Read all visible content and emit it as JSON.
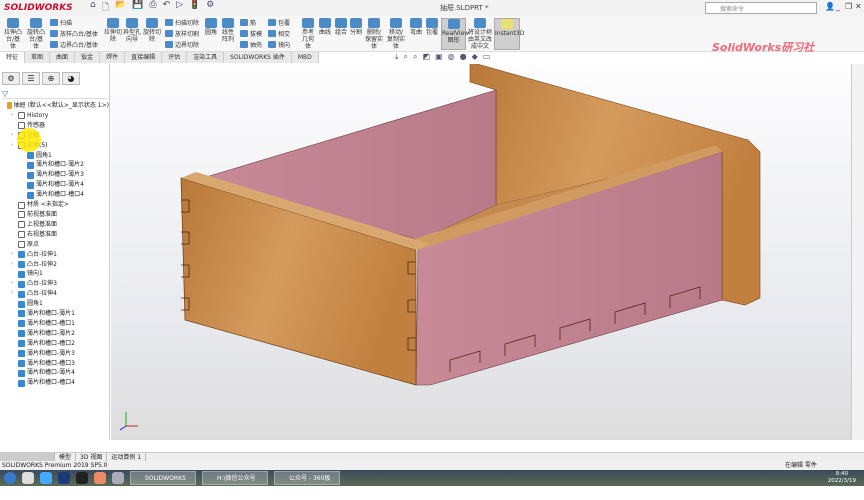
{
  "app": {
    "logo": "SOLIDWORKS",
    "doc_title": "抽屉.SLDPRT *",
    "search_placeholder": "搜索命令",
    "brand_watermark": "SolidWorks研习社"
  },
  "ribbon": {
    "big": [
      "拉伸凸台/基体",
      "旋转凸台/基体",
      "拉伸切除",
      "异型孔向导",
      "旋转切除",
      "圆角",
      "线性阵列",
      "参考几何体",
      "曲线",
      "组合",
      "分割",
      "删除/保留实体",
      "移动/复制实体",
      "弯曲",
      "包覆",
      "RealView图形",
      "将设计树由英文改成中文",
      "Instant3D"
    ],
    "small": [
      "扫描",
      "放样凸台/基体",
      "边界凸台/基体",
      "扫描切除",
      "放样切割",
      "边界切除",
      "筋",
      "拔模",
      "抽壳",
      "包覆",
      "相交",
      "镜向"
    ]
  },
  "tabs": [
    "特征",
    "草图",
    "曲面",
    "钣金",
    "焊件",
    "直接编辑",
    "评估",
    "渲染工具",
    "SOLIDWORKS 插件",
    "MBD"
  ],
  "tree": [
    {
      "label": "抽屉 (默认<<默认>_显示状态 1>)",
      "icon": "part",
      "level": 0
    },
    {
      "label": "History",
      "icon": "folder",
      "level": 1,
      "arrow": true
    },
    {
      "label": "传感器",
      "icon": "folder",
      "level": 1
    },
    {
      "label": "注解",
      "icon": "folder",
      "level": 1,
      "arrow": true
    },
    {
      "label": "实体(5)",
      "icon": "folder",
      "level": 1,
      "arrow": true
    },
    {
      "label": "圆角1",
      "icon": "body",
      "level": 2
    },
    {
      "label": "薄片和槽口-薄片2",
      "icon": "body",
      "level": 2
    },
    {
      "label": "薄片和槽口-薄片3",
      "icon": "body",
      "level": 2
    },
    {
      "label": "薄片和槽口-薄片4",
      "icon": "body",
      "level": 2
    },
    {
      "label": "薄片和槽口-槽口4",
      "icon": "body",
      "level": 2
    },
    {
      "label": "材质 <未指定>",
      "icon": "material",
      "level": 1
    },
    {
      "label": "前视基准面",
      "icon": "plane",
      "level": 1
    },
    {
      "label": "上视基准面",
      "icon": "plane",
      "level": 1
    },
    {
      "label": "右视基准面",
      "icon": "plane",
      "level": 1
    },
    {
      "label": "原点",
      "icon": "origin",
      "level": 1
    },
    {
      "label": "凸台-拉伸1",
      "icon": "feature",
      "level": 1,
      "arrow": true
    },
    {
      "label": "凸台-拉伸2",
      "icon": "feature",
      "level": 1,
      "arrow": true
    },
    {
      "label": "镜向1",
      "icon": "feature",
      "level": 1
    },
    {
      "label": "凸台-拉伸3",
      "icon": "feature",
      "level": 1,
      "arrow": true
    },
    {
      "label": "凸台-拉伸4",
      "icon": "feature",
      "level": 1,
      "arrow": true
    },
    {
      "label": "圆角1",
      "icon": "feature",
      "level": 1
    },
    {
      "label": "薄片和槽口-薄片1",
      "icon": "feature",
      "level": 1
    },
    {
      "label": "薄片和槽口-槽口1",
      "icon": "feature",
      "level": 1
    },
    {
      "label": "薄片和槽口-薄片2",
      "icon": "feature",
      "level": 1
    },
    {
      "label": "薄片和槽口-槽口2",
      "icon": "feature",
      "level": 1
    },
    {
      "label": "薄片和槽口-薄片3",
      "icon": "feature",
      "level": 1
    },
    {
      "label": "薄片和槽口-槽口3",
      "icon": "feature",
      "level": 1
    },
    {
      "label": "薄片和槽口-薄片4",
      "icon": "feature",
      "level": 1
    },
    {
      "label": "薄片和槽口-槽口4",
      "icon": "feature",
      "level": 1
    }
  ],
  "bottom_tabs": [
    "模型",
    "3D 视图",
    "运动算例 1"
  ],
  "status": {
    "left": "SOLIDWORKS Premium 2019 SP5.0",
    "right": "在编辑 零件"
  },
  "taskbar": {
    "windows": [
      "SOLIDWORKS P...",
      "H:\\微信公众号\\0...",
      "公众号 - 360极速..."
    ],
    "time": "8:40",
    "date": "2022/3/19"
  },
  "colors": {
    "wood": "#c98a4b",
    "pink": "#c98a98",
    "accent": "#c8102e"
  }
}
